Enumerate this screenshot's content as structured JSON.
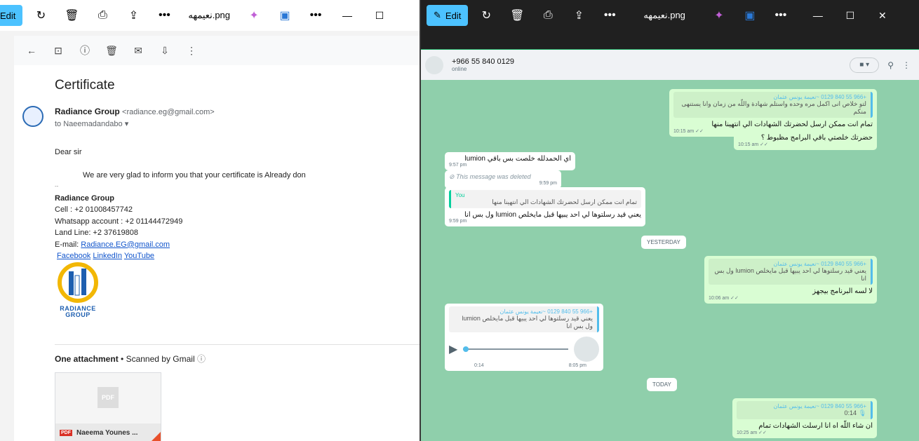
{
  "viewer": {
    "edit_label": "Edit",
    "file_title": "نعيمهه.png"
  },
  "gmail": {
    "subject": "Certificate",
    "sender_name": "Radiance Group",
    "sender_email": "<radiance.eg@gmail.com>",
    "to_line": "to Naeemadandabo",
    "greeting": "Dear sir",
    "body_line": "We are very glad to inform you that your certificate is Already don",
    "sig_dash": "--",
    "sig_name": "Radiance Group",
    "sig_cell": "Cell : +2 01008457742",
    "sig_whatsapp": "Whatsapp account : +2 01144472949",
    "sig_landline": "Land Line: +2 37619808",
    "sig_email_label": "E-mail: ",
    "sig_email": "Radiance.EG@gmail.com",
    "links": [
      "Facebook",
      "LinkedIn",
      "YouTube"
    ],
    "logo_text_1": "RADIANCE",
    "logo_text_2": "GROUP",
    "attach_count": "One attachment",
    "attach_scan": "• Scanned by Gmail",
    "attach_thumb_label": "PDF",
    "attach_name": "Naeema Younes ...",
    "attach_badge": "PDF"
  },
  "whatsapp": {
    "contact_phone": "+966 55 840 0129",
    "contact_status": "online",
    "messages": [
      {
        "quote_author": "+966 55 840 0129 ~نعيمة يونس عثمان",
        "quote_text": "لتو خلاص انى اكمل مره وحده واستلم شهادة واللّه من زمان وانا يستنهى منكم",
        "text": "تمام انت ممكن ارسل لحضرتك الشهادات الي انتهينا منها",
        "time": "10:15 am"
      },
      {
        "text": "حضرتك خلصتي باقي البرامج مظبوط ؟",
        "time": "10:15 am"
      },
      {
        "text": "اي الحمدلله خلصت بس باقي lumion",
        "time": "9:57 pm"
      },
      {
        "text": "This message was deleted",
        "time": "9:59 pm"
      },
      {
        "quote_author": "You",
        "quote_text": "تمام انت ممكن ارسل لحضرتك الشهادات الي انتهينا منها",
        "text": "يعني قيد رسلتوها لي احد يبيها قبل مايخلص lumion ول بس انا",
        "time": "9:59 pm"
      },
      {
        "quote_author": "+966 55 840 0129 ~نعيمة يونس عثمان",
        "quote_text": "يعني قيد رسلتوها لي احد يبيها قبل مايخلص lumion ول بس انا",
        "text": "لا لسه البرنامج بيجهز",
        "time": "10:06 am"
      },
      {
        "quote_author": "+966 55 840 0129 ~نعيمة يونس عثمان",
        "quote_text": "يعني قيد رسلتوها لي احد يبيها قبل مايخلص lumion ول بس انا",
        "voice_duration": "0:14",
        "time": "8:05 pm"
      },
      {
        "quote_author": "+966 55 840 0129 ~نعيمة يونس عثمان",
        "quote_text": "0:14",
        "text": "ان شاء اللّه اه انا ارسلت الشهادات تمام",
        "time": "10:25 am"
      }
    ],
    "day_yesterday": "YESTERDAY",
    "day_today": "TODAY"
  }
}
